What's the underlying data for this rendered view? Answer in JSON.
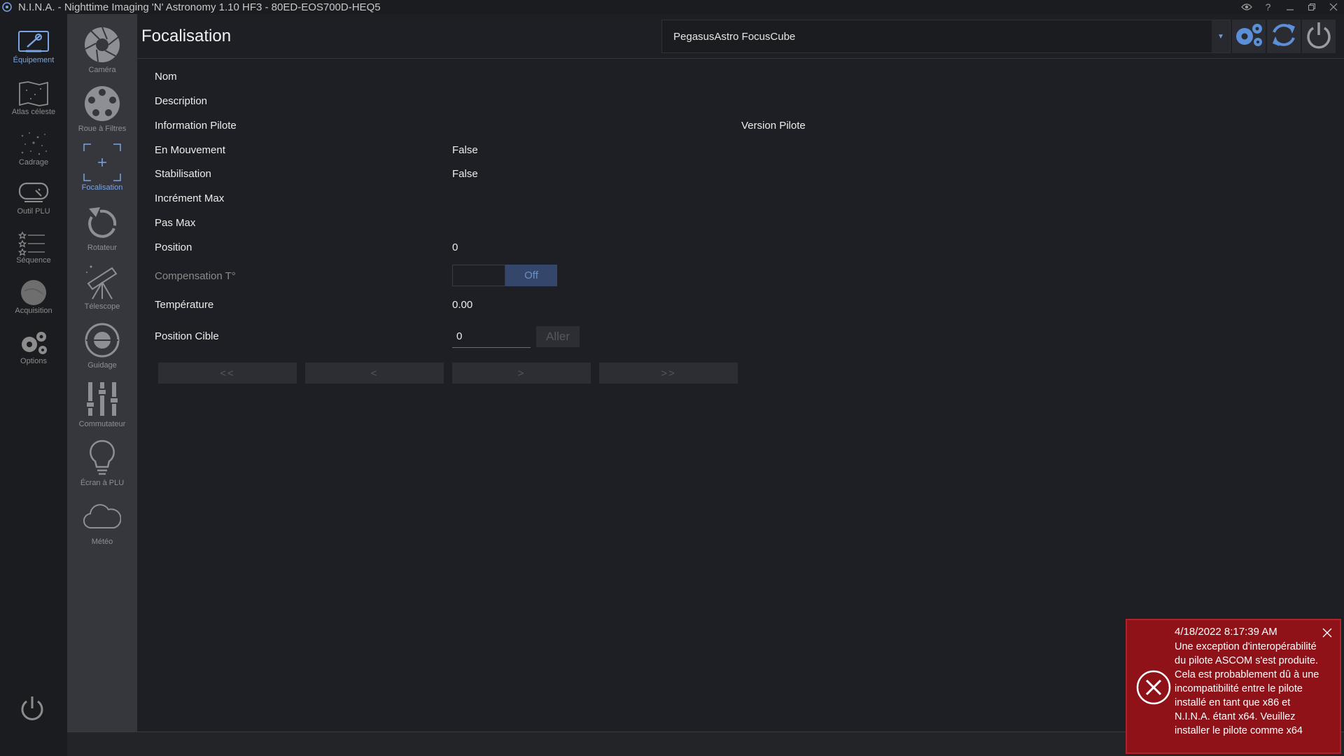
{
  "window": {
    "title": "N.I.N.A. - Nighttime Imaging 'N' Astronomy 1.10 HF3   -  80ED-EOS700D-HEQ5",
    "controls": [
      "eye-icon",
      "help-icon",
      "minimize-icon",
      "restore-icon",
      "close-icon"
    ]
  },
  "main_nav": {
    "items": [
      {
        "label": "Équipement",
        "icon": "equipment-icon",
        "active": true
      },
      {
        "label": "Atlas céleste",
        "icon": "sky-atlas-icon",
        "active": false
      },
      {
        "label": "Cadrage",
        "icon": "framing-icon",
        "active": false
      },
      {
        "label": "Outil PLU",
        "icon": "flat-wizard-icon",
        "active": false
      },
      {
        "label": "Séquence",
        "icon": "sequence-icon",
        "active": false
      },
      {
        "label": "Acquisition",
        "icon": "imaging-icon",
        "active": false
      },
      {
        "label": "Options",
        "icon": "options-icon",
        "active": false
      }
    ],
    "power_icon": "power-icon"
  },
  "sub_nav": {
    "items": [
      {
        "label": "Caméra",
        "icon": "camera-icon",
        "active": false
      },
      {
        "label": "Roue à Filtres",
        "icon": "filter-wheel-icon",
        "active": false
      },
      {
        "label": "Focalisation",
        "icon": "focuser-icon",
        "active": true
      },
      {
        "label": "Rotateur",
        "icon": "rotator-icon",
        "active": false
      },
      {
        "label": "Télescope",
        "icon": "telescope-icon",
        "active": false
      },
      {
        "label": "Guidage",
        "icon": "guider-icon",
        "active": false
      },
      {
        "label": "Commutateur",
        "icon": "switch-icon",
        "active": false
      },
      {
        "label": "Écran à PLU",
        "icon": "flat-panel-icon",
        "active": false
      },
      {
        "label": "Météo",
        "icon": "weather-icon",
        "active": false
      }
    ]
  },
  "header": {
    "title": "Focalisation",
    "device": "PegasusAstro FocusCube",
    "buttons": [
      "settings-icon",
      "refresh-icon",
      "power-icon"
    ]
  },
  "properties": {
    "name_label": "Nom",
    "description_label": "Description",
    "driver_info_label": "Information Pilote",
    "driver_version_label": "Version Pilote",
    "moving_label": "En Mouvement",
    "moving_value": "False",
    "settling_label": "Stabilisation",
    "settling_value": "False",
    "max_increment_label": "Incrément Max",
    "max_step_label": "Pas Max",
    "position_label": "Position",
    "position_value": "0",
    "temp_comp_label": "Compensation T°",
    "temp_comp_state": "Off",
    "temperature_label": "Température",
    "temperature_value": "0.00",
    "target_label": "Position Cible",
    "target_value": "0",
    "goto_label": "Aller"
  },
  "step_buttons": {
    "fast_in": "<<",
    "in": "<",
    "out": ">",
    "fast_out": ">>"
  },
  "toast": {
    "timestamp": "4/18/2022 8:17:39 AM",
    "message": "Une exception d'interopérabilité du pilote ASCOM s'est produite. Cela est probablement dû à une incompatibilité entre le pilote installé en tant que x86 et N.I.N.A. étant x64. Veuillez installer le pilote comme x64"
  },
  "colors": {
    "accent": "#7aa4e4",
    "background": "#1e1f24",
    "sidebar": "#35373d",
    "error": "#8e1218"
  }
}
